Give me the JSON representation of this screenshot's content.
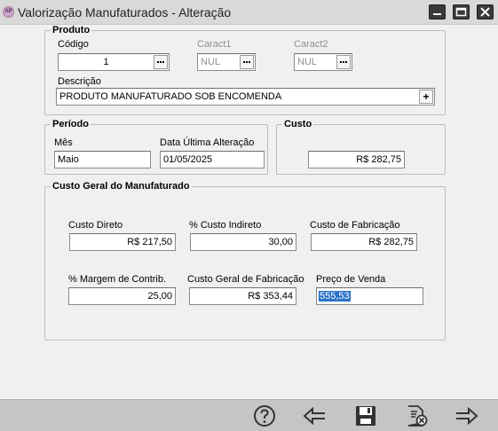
{
  "window": {
    "title": "Valorização Manufaturados - Alteração",
    "app_icon_text": "AP"
  },
  "produto": {
    "group_title": "Produto",
    "codigo_label": "Código",
    "codigo_value": "1",
    "caract1_label": "Caract1",
    "caract1_value": "NUL",
    "caract2_label": "Caract2",
    "caract2_value": "NUL",
    "descricao_label": "Descrição",
    "descricao_value": "PRODUTO MANUFATURADO SOB ENCOMENDA",
    "descricao_button": "+"
  },
  "periodo": {
    "group_title": "Período",
    "mes_label": "Mês",
    "mes_value": "Maio",
    "data_label": "Data Última Alteração",
    "data_value": "01/05/2025"
  },
  "custo": {
    "group_title": "Custo",
    "value": "R$ 282,75"
  },
  "custo_geral": {
    "group_title": "Custo Geral do Manufaturado",
    "custo_direto_label": "Custo Direto",
    "custo_direto_value": "R$ 217,50",
    "pct_custo_indireto_label": "% Custo Indireto",
    "pct_custo_indireto_value": "30,00",
    "custo_fabricacao_label": "Custo de Fabricação",
    "custo_fabricacao_value": "R$ 282,75",
    "pct_margem_label": "% Margem de Contrib.",
    "pct_margem_value": "25,00",
    "custo_geral_fab_label": "Custo Geral de Fabricação",
    "custo_geral_fab_value": "R$ 353,44",
    "preco_venda_label": "Preço de Venda",
    "preco_venda_value": "555,53"
  },
  "toolbar": {
    "icons": [
      "help-icon",
      "back-arrow-icon",
      "save-icon",
      "cancel-document-icon",
      "forward-arrow-icon"
    ]
  },
  "colors": {
    "selection": "#2a72c6",
    "titlebar": "#d9d9d9",
    "bottombar": "#c5c5c5"
  }
}
